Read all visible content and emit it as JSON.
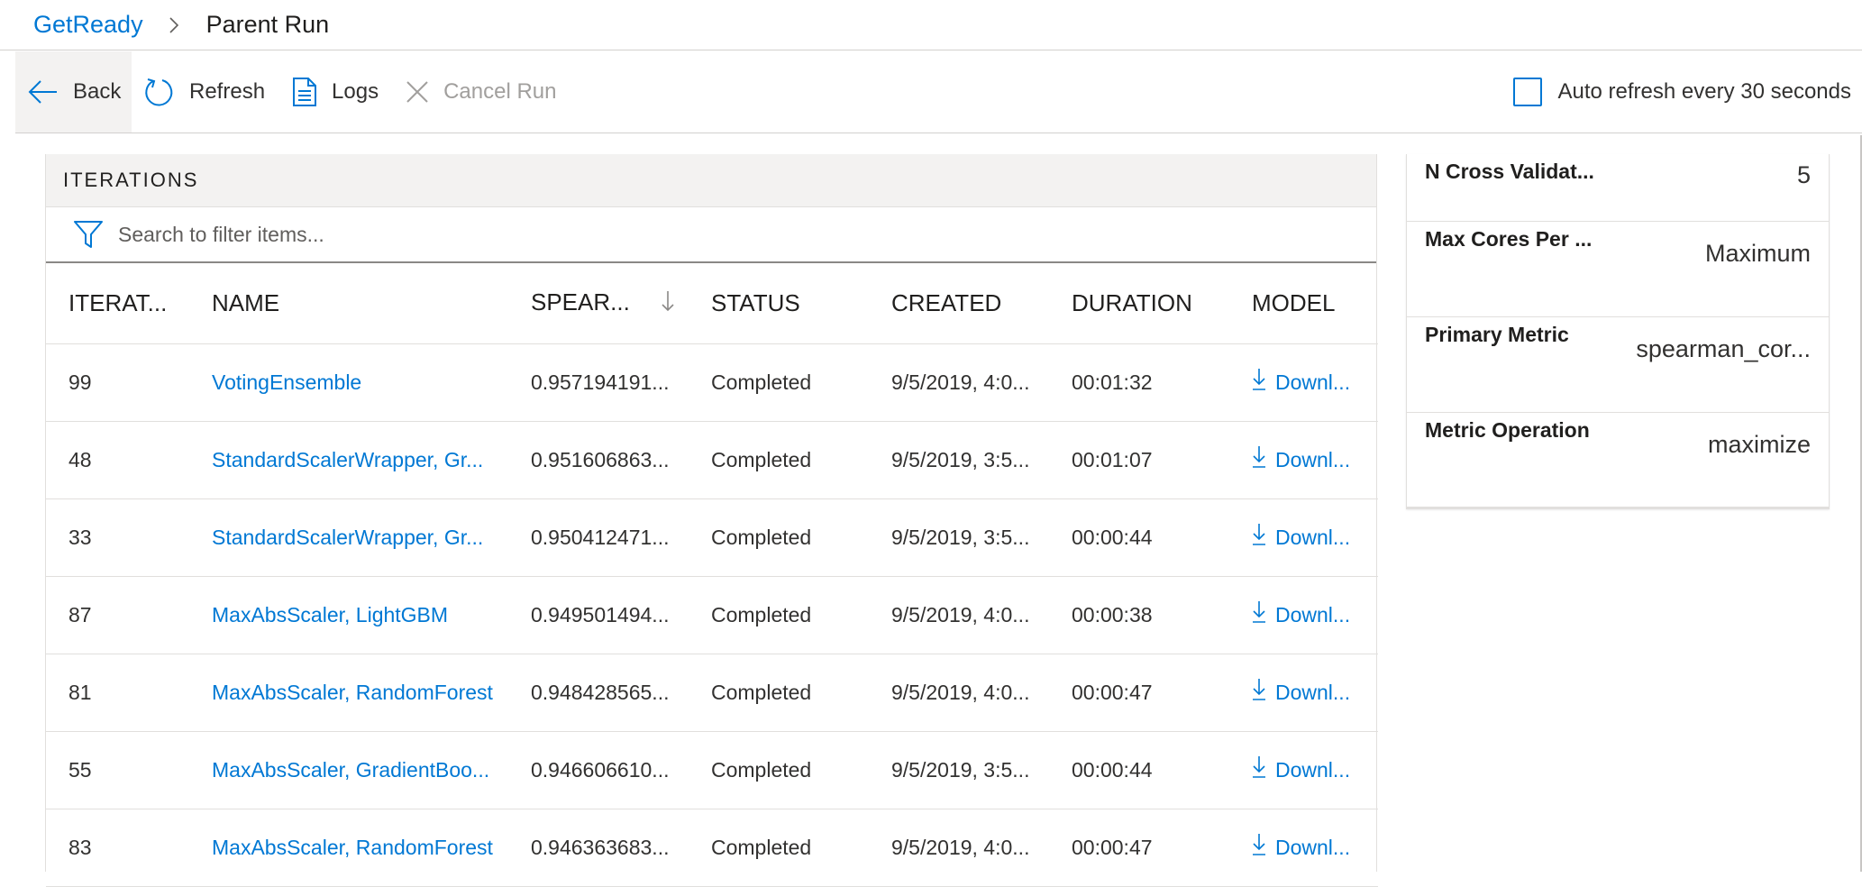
{
  "breadcrumb": {
    "root": "GetReady",
    "current": "Parent Run"
  },
  "toolbar": {
    "back": "Back",
    "refresh": "Refresh",
    "logs": "Logs",
    "cancel": "Cancel Run",
    "auto_refresh": "Auto refresh every 30 seconds"
  },
  "iterations": {
    "title": "ITERATIONS",
    "search_placeholder": "Search to filter items...",
    "columns": [
      "ITERAT...",
      "NAME",
      "SPEAR...",
      "STATUS",
      "CREATED",
      "DURATION",
      "MODEL"
    ],
    "rows": [
      {
        "iteration": "99",
        "name": "VotingEnsemble",
        "score": "0.957194191...",
        "status": "Completed",
        "created": "9/5/2019, 4:0...",
        "duration": "00:01:32",
        "model": "Downl..."
      },
      {
        "iteration": "48",
        "name": "StandardScalerWrapper, Gr...",
        "score": "0.951606863...",
        "status": "Completed",
        "created": "9/5/2019, 3:5...",
        "duration": "00:01:07",
        "model": "Downl..."
      },
      {
        "iteration": "33",
        "name": "StandardScalerWrapper, Gr...",
        "score": "0.950412471...",
        "status": "Completed",
        "created": "9/5/2019, 3:5...",
        "duration": "00:00:44",
        "model": "Downl..."
      },
      {
        "iteration": "87",
        "name": "MaxAbsScaler, LightGBM",
        "score": "0.949501494...",
        "status": "Completed",
        "created": "9/5/2019, 4:0...",
        "duration": "00:00:38",
        "model": "Downl..."
      },
      {
        "iteration": "81",
        "name": "MaxAbsScaler, RandomForest",
        "score": "0.948428565...",
        "status": "Completed",
        "created": "9/5/2019, 4:0...",
        "duration": "00:00:47",
        "model": "Downl..."
      },
      {
        "iteration": "55",
        "name": "MaxAbsScaler, GradientBoo...",
        "score": "0.946606610...",
        "status": "Completed",
        "created": "9/5/2019, 3:5...",
        "duration": "00:00:44",
        "model": "Downl..."
      },
      {
        "iteration": "83",
        "name": "MaxAbsScaler, RandomForest",
        "score": "0.946363683...",
        "status": "Completed",
        "created": "9/5/2019, 4:0...",
        "duration": "00:00:47",
        "model": "Downl..."
      }
    ]
  },
  "properties": [
    {
      "label": "N Cross Validat...",
      "value": "5"
    },
    {
      "label": "Max Cores Per ...",
      "value": "Maximum"
    },
    {
      "label": "Primary Metric",
      "value": "spearman_cor..."
    },
    {
      "label": "Metric Operation",
      "value": "maximize"
    }
  ],
  "colors": {
    "accent": "#0078d4",
    "text": "#201f1e",
    "disabled": "#a19f9d",
    "header_bg": "#f3f2f1"
  },
  "icons": [
    "chevron-right-icon",
    "back-arrow-icon",
    "refresh-icon",
    "document-icon",
    "close-icon",
    "filter-icon",
    "sort-down-icon",
    "download-icon"
  ]
}
